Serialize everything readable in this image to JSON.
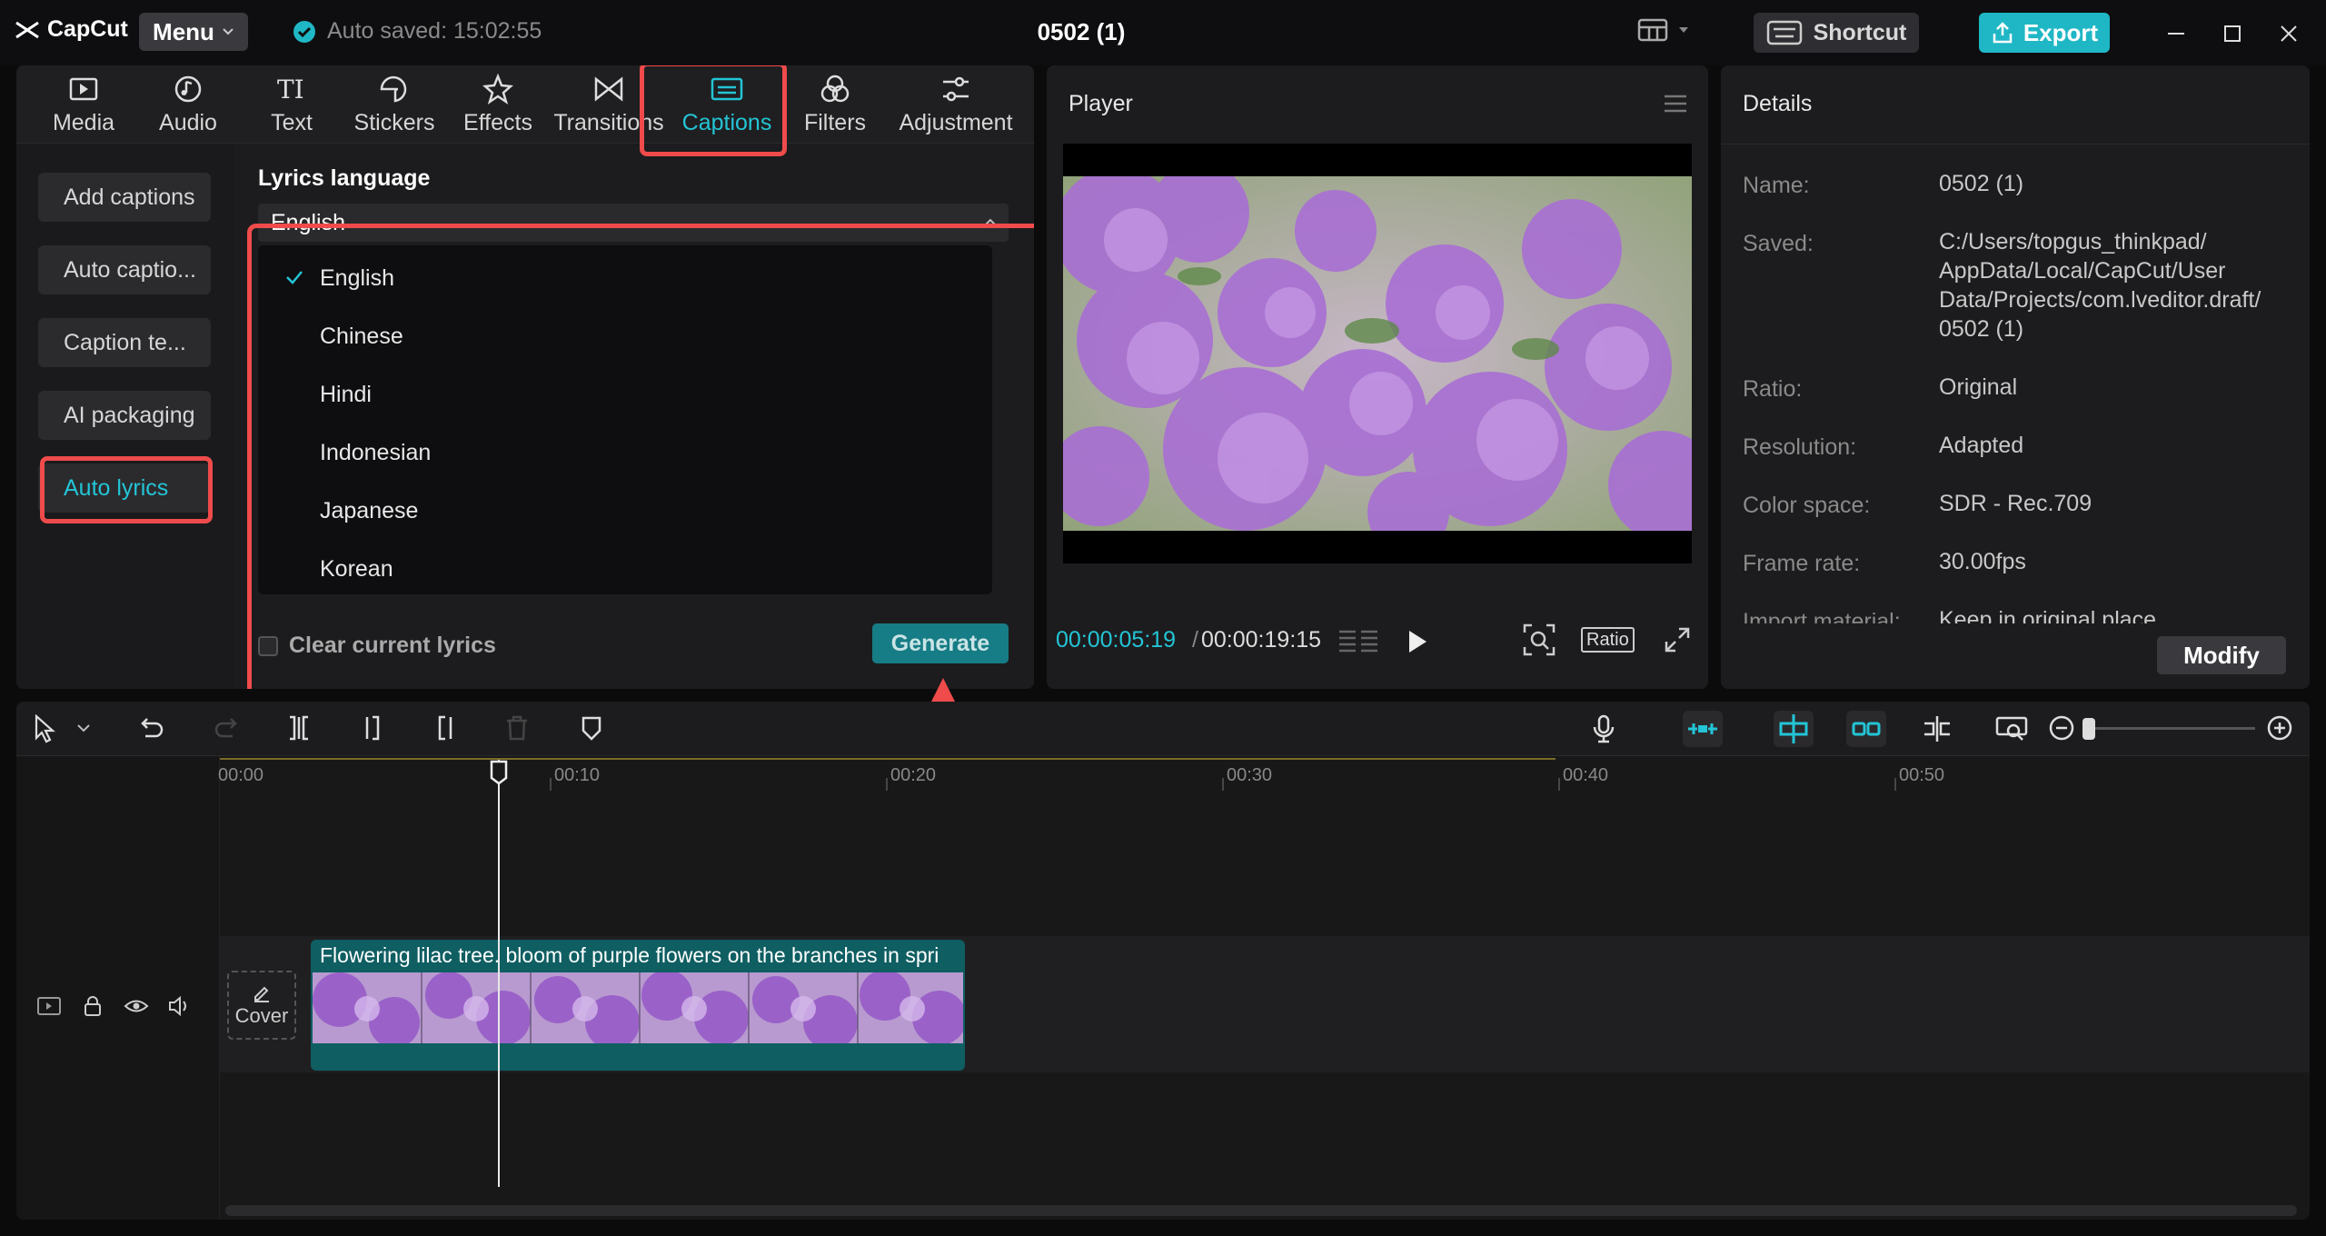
{
  "app": {
    "logo_text": "CapCut",
    "menu_label": "Menu",
    "autosave_text": "Auto saved: 15:02:55",
    "project_title": "0502 (1)",
    "shortcut_label": "Shortcut",
    "export_label": "Export",
    "accent_color": "#1fb7c5",
    "highlight_color": "#ef4b4b"
  },
  "tabs": [
    {
      "label": "Media",
      "icon": "media-icon"
    },
    {
      "label": "Audio",
      "icon": "audio-icon"
    },
    {
      "label": "Text",
      "icon": "text-icon"
    },
    {
      "label": "Stickers",
      "icon": "sticker-icon"
    },
    {
      "label": "Effects",
      "icon": "effects-icon"
    },
    {
      "label": "Transitions",
      "icon": "transition-icon"
    },
    {
      "label": "Captions",
      "icon": "captions-icon",
      "active": true
    },
    {
      "label": "Filters",
      "icon": "filters-icon"
    },
    {
      "label": "Adjustment",
      "icon": "adjustment-icon"
    }
  ],
  "subnav": [
    {
      "label": "Add captions"
    },
    {
      "label": "Auto captio..."
    },
    {
      "label": "Caption te..."
    },
    {
      "label": "AI packaging"
    },
    {
      "label": "Auto lyrics",
      "active": true
    }
  ],
  "lyrics": {
    "title": "Lyrics language",
    "selected": "English",
    "options": [
      "English",
      "Chinese",
      "Hindi",
      "Indonesian",
      "Japanese",
      "Korean"
    ],
    "clear_label": "Clear current lyrics",
    "generate_label": "Generate"
  },
  "player": {
    "title": "Player",
    "current_time": "00:00:05:19",
    "total_time": "00:00:19:15",
    "ratio_label": "Ratio"
  },
  "details": {
    "title": "Details",
    "rows": [
      {
        "label": "Name:",
        "value": "0502 (1)"
      },
      {
        "label": "Saved:",
        "value": "C:/Users/topgus_thinkpad/ AppData/Local/CapCut/User Data/Projects/com.lveditor.draft/ 0502 (1)"
      },
      {
        "label": "Ratio:",
        "value": "Original"
      },
      {
        "label": "Resolution:",
        "value": "Adapted"
      },
      {
        "label": "Color space:",
        "value": "SDR - Rec.709"
      },
      {
        "label": "Frame rate:",
        "value": "30.00fps"
      },
      {
        "label": "Import material:",
        "value": "Keep in original place"
      }
    ],
    "modify_label": "Modify"
  },
  "timeline": {
    "ruler": [
      "00:00",
      "00:10",
      "00:20",
      "00:30",
      "00:40",
      "00:50"
    ],
    "cover_label": "Cover",
    "clip_title": "Flowering lilac tree. bloom of purple flowers on the branches in spri"
  }
}
